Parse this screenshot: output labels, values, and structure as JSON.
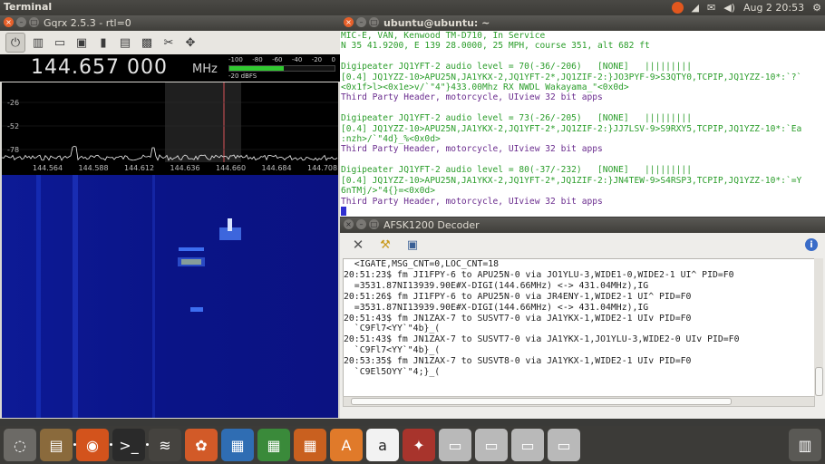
{
  "top_panel": {
    "app_title": "Terminal",
    "clock": "Aug  2 20:53",
    "icons": [
      "ubuntu-update-icon",
      "wifi-icon",
      "mail-icon",
      "volume-icon",
      "gear-icon"
    ]
  },
  "gqrx": {
    "window_title": "Gqrx 2.5.3 - rtl=0",
    "toolbar_icons": [
      "power-icon",
      "device-icon",
      "open-icon",
      "save-icon",
      "record-icon",
      "fft-icon",
      "remote-icon",
      "settings-icon",
      "move-icon"
    ],
    "frequency": "144.657 000",
    "unit": "MHz",
    "smeter_scale": [
      "-100",
      "-80",
      "-60",
      "-40",
      "-20",
      "0"
    ],
    "smeter_level": 0.52,
    "smeter_label": "-20 dBFS",
    "spectrum_ylabels": [
      "-26",
      "-52",
      "-78"
    ],
    "spectrum_xlabels": [
      "144.564",
      "144.588",
      "144.612",
      "144.636",
      "144.660",
      "144.684",
      "144.708"
    ]
  },
  "terminal": {
    "window_title": "ubuntu@ubuntu: ~",
    "lines": [
      {
        "text": "MIC-E, VAN, Kenwood TM-D710, In Service",
        "color": "green"
      },
      {
        "text": "N 35 41.9200, E 139 28.0000, 25 MPH, course 351, alt 682 ft",
        "color": "green"
      },
      {
        "text": "",
        "color": "green"
      },
      {
        "text": "Digipeater JQ1YFT-2 audio level = 70(-36/-206)   [NONE]   |||||||||",
        "color": "green"
      },
      {
        "text": "[0.4] JQ1YZZ-10>APU25N,JA1YKX-2,JQ1YFT-2*,JQ1ZIF-2:}JO3PYF-9>S3QTY0,TCPIP,JQ1YZZ-10*:`?`",
        "color": "green"
      },
      {
        "text": "<0x1f>l><0x1e>v/`\"4\"}433.00Mhz RX NWDL Wakayama_\"<0x0d>",
        "color": "green"
      },
      {
        "text": "Third Party Header, motorcycle, UIview 32 bit apps",
        "color": "purple"
      },
      {
        "text": "",
        "color": "green"
      },
      {
        "text": "Digipeater JQ1YFT-2 audio level = 73(-26/-205)   [NONE]   |||||||||",
        "color": "green"
      },
      {
        "text": "[0.4] JQ1YZZ-10>APU25N,JA1YKX-2,JQ1YFT-2*,JQ1ZIF-2:}JJ7LSV-9>S9RXY5,TCPIP,JQ1YZZ-10*:`Ea",
        "color": "green"
      },
      {
        "text": ":nzh>/`\"4d}_%<0x0d>",
        "color": "green"
      },
      {
        "text": "Third Party Header, motorcycle, UIview 32 bit apps",
        "color": "purple"
      },
      {
        "text": "",
        "color": "green"
      },
      {
        "text": "Digipeater JQ1YFT-2 audio level = 80(-37/-232)   [NONE]   |||||||||",
        "color": "green"
      },
      {
        "text": "[0.4] JQ1YZZ-10>APU25N,JA1YKX-2,JQ1YFT-2*,JQ1ZIF-2:}JN4TEW-9>S4RSP3,TCPIP,JQ1YZZ-10*:`=Y",
        "color": "green"
      },
      {
        "text": "6nTMj/>\"4{}=<0x0d>",
        "color": "green"
      },
      {
        "text": "Third Party Header, motorcycle, UIview 32 bit apps",
        "color": "purple"
      }
    ]
  },
  "decoder": {
    "window_title": "AFSK1200 Decoder",
    "toolbar_icons": [
      "clear-icon",
      "broom-icon",
      "save-icon",
      "info-icon"
    ],
    "lines": [
      "  <IGATE,MSG_CNT=0,LOC_CNT=18",
      "20:51:23$ fm JI1FPY-6 to APU25N-0 via JO1YLU-3,WIDE1-0,WIDE2-1 UI^ PID=F0",
      "  =3531.87NI13939.90E#X-DIGI(144.66MHz) <-> 431.04MHz),IG",
      "20:51:26$ fm JI1FPY-6 to APU25N-0 via JR4ENY-1,WIDE2-1 UI^ PID=F0",
      "  =3531.87NI13939.90E#X-DIGI(144.66MHz) <-> 431.04MHz),IG",
      "20:51:43$ fm JN1ZAX-7 to SUSVT7-0 via JA1YKX-1,WIDE2-1 UIv PID=F0",
      "  `C9Fl7<YY`\"4b}_(",
      "20:51:43$ fm JN1ZAX-7 to SUSVT7-0 via JA1YKX-1,JO1YLU-3,WIDE2-0 UIv PID=F0",
      "  `C9Fl7<YY`\"4b}_(",
      "20:53:35$ fm JN1ZAX-7 to SUSVT8-0 via JA1YKX-1,WIDE2-1 UIv PID=F0",
      "  `C9El5OYY`\"4;}_("
    ]
  },
  "launcher": {
    "apps": [
      {
        "name": "dash-icon",
        "glyph": "◌",
        "bg": "#6c6a66"
      },
      {
        "name": "files-icon",
        "glyph": "▤",
        "bg": "#8a6a3c"
      },
      {
        "name": "firefox-icon",
        "glyph": "◉",
        "bg": "#d3531c"
      },
      {
        "name": "terminal-icon",
        "glyph": ">_",
        "bg": "#2a2a2a"
      },
      {
        "name": "gqrx-icon",
        "glyph": "≋",
        "bg": "#45433f"
      },
      {
        "name": "ubuntu-software-icon",
        "glyph": "✿",
        "bg": "#d25a28"
      },
      {
        "name": "writer-icon",
        "glyph": "▦",
        "bg": "#2f6db3"
      },
      {
        "name": "calc-icon",
        "glyph": "▦",
        "bg": "#3a8a3a"
      },
      {
        "name": "impress-icon",
        "glyph": "▦",
        "bg": "#c9601f"
      },
      {
        "name": "software-center-icon",
        "glyph": "A",
        "bg": "#e07a2a"
      },
      {
        "name": "amazon-icon",
        "glyph": "a",
        "bg": "#f2f2f2"
      },
      {
        "name": "system-settings-icon",
        "glyph": "✦",
        "bg": "#a8342c"
      },
      {
        "name": "drive-icon-1",
        "glyph": "▭",
        "bg": "#b9b9b9"
      },
      {
        "name": "drive-icon-2",
        "glyph": "▭",
        "bg": "#b9b9b9"
      },
      {
        "name": "drive-icon-3",
        "glyph": "▭",
        "bg": "#b9b9b9"
      },
      {
        "name": "drive-icon-4",
        "glyph": "▭",
        "bg": "#b9b9b9"
      }
    ],
    "trash": {
      "name": "trash-icon",
      "glyph": "🗑"
    }
  }
}
